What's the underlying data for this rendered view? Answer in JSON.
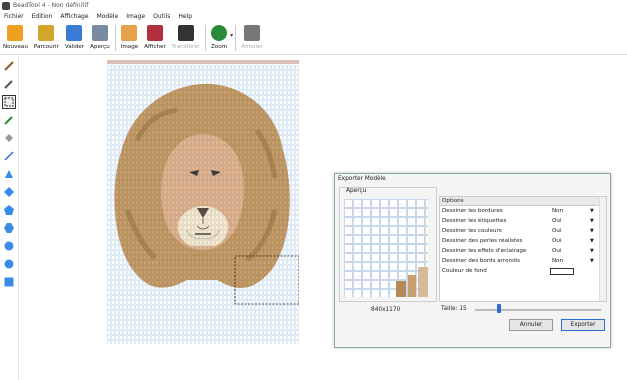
{
  "window": {
    "title": "BeadTool 4 - Non définitif"
  },
  "menu": [
    "Fichier",
    "Edition",
    "Affichage",
    "Modèle",
    "Image",
    "Outils",
    "Help"
  ],
  "toolbar": [
    {
      "label": "Nouveau",
      "icon": "new-icon",
      "color": "#f0a020",
      "disabled": false
    },
    {
      "label": "Parcourir",
      "icon": "open-folder-icon",
      "color": "#d4a52c",
      "disabled": false
    },
    {
      "label": "Valider",
      "icon": "save-icon",
      "color": "#3a7bd5",
      "disabled": false
    },
    {
      "label": "Aperçu",
      "icon": "print-preview-icon",
      "color": "#7a8aa0",
      "disabled": false
    },
    {
      "label": "Image",
      "icon": "image-icon",
      "color": "#e8a24a",
      "disabled": false
    },
    {
      "label": "Afficher",
      "icon": "display-icon",
      "color": "#b03040",
      "disabled": false
    },
    {
      "label": "Transférer",
      "icon": "transfer-icon",
      "color": "#333333",
      "disabled": true
    },
    {
      "label": "Zoom",
      "icon": "zoom-icon",
      "color": "#2a8a3a",
      "disabled": false
    },
    {
      "label": "Annuler",
      "icon": "undo-icon",
      "color": "#777777",
      "disabled": true
    }
  ],
  "tools": [
    "pencil-icon",
    "eyedropper-icon",
    "rectangle-select-icon",
    "color-picker-icon",
    "fill-bucket-icon",
    "line-icon",
    "triangle-icon",
    "diamond-icon",
    "pentagon-icon",
    "hexagon-icon",
    "circle-icon",
    "circle-icon",
    "square-icon"
  ],
  "dialog": {
    "title": "Exporter Modèle",
    "preview_label": "Aperçu",
    "preview_size": "840x1170",
    "options_header": "Options",
    "options": [
      {
        "name": "Dessiner les bordures",
        "value": "Non"
      },
      {
        "name": "Dessiner les étiquettes",
        "value": "Oui"
      },
      {
        "name": "Dessiner les couleurs",
        "value": "Oui"
      },
      {
        "name": "Dessiner des perles réalistes",
        "value": "Oui"
      },
      {
        "name": "Dessiner les effets d'éclairage",
        "value": "Oui"
      },
      {
        "name": "Dessiner des bords arrondis",
        "value": "Non"
      }
    ],
    "bg_color_label": "Couleur de fond",
    "size_label": "Taille: 15",
    "size_value": 15,
    "cancel_label": "Annuler",
    "export_label": "Exporter"
  },
  "colors": {
    "accent": "#2b6fd1",
    "grid": "#c9dcef",
    "mane": "#c8a070",
    "face": "#e0b898"
  }
}
